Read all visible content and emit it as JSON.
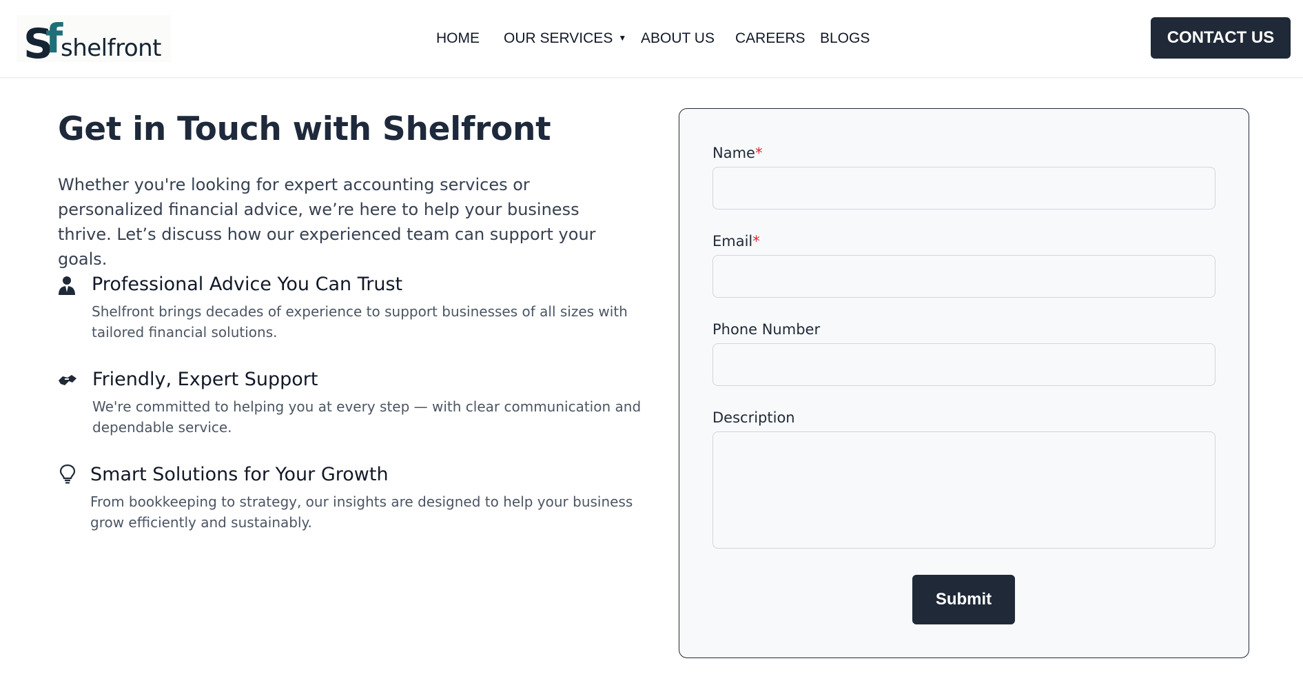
{
  "brand": {
    "name": "shelfront",
    "mark_letters": "Sf",
    "colors": {
      "dark": "#142433",
      "accent": "#1f6f78"
    }
  },
  "nav": {
    "items": [
      {
        "label": "HOME"
      },
      {
        "label": "OUR SERVICES",
        "has_dropdown": true,
        "caret": "▼"
      },
      {
        "label": "ABOUT US"
      },
      {
        "label": "CAREERS"
      },
      {
        "label": "BLOGS"
      }
    ],
    "cta_label": "CONTACT US"
  },
  "main": {
    "title": "Get in Touch with Shelfront",
    "intro": "Whether you're looking for expert accounting services or personalized financial advice, we’re here to help your business thrive. Let’s discuss how our experienced team can support your goals.",
    "features": [
      {
        "icon": "professional-person-icon",
        "title": "Professional Advice You Can Trust",
        "description": "Shelfront brings decades of experience to support businesses of all sizes with tailored financial solutions."
      },
      {
        "icon": "handshake-icon",
        "title": "Friendly, Expert Support",
        "description": "We're committed to helping you at every step — with clear communication and dependable service."
      },
      {
        "icon": "lightbulb-icon",
        "title": "Smart Solutions for Your Growth",
        "description": "From bookkeeping to strategy, our insights are designed to help your business grow efficiently and sustainably."
      }
    ]
  },
  "form": {
    "fields": {
      "name": {
        "label": "Name",
        "required_mark": "*",
        "value": "",
        "placeholder": ""
      },
      "email": {
        "label": "Email",
        "required_mark": "*",
        "value": "",
        "placeholder": ""
      },
      "phone": {
        "label": "Phone Number",
        "value": "",
        "placeholder": ""
      },
      "description": {
        "label": "Description",
        "value": "",
        "placeholder": ""
      }
    },
    "submit_label": "Submit"
  },
  "colors": {
    "primary_button": "#1f2937",
    "required": "#dc2626",
    "form_background": "#f8f9fb"
  }
}
